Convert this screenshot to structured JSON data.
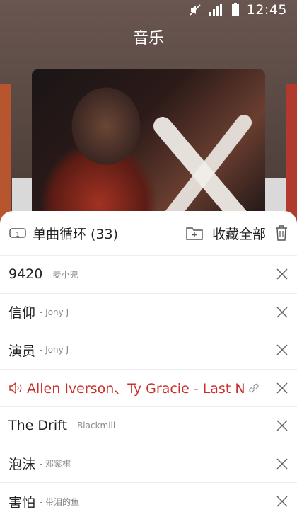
{
  "status_bar": {
    "time": "12:45"
  },
  "header": {
    "title": "音乐"
  },
  "playlist": {
    "mode_label": "单曲循环 (33)",
    "collect_label": "收藏全部",
    "tracks": [
      {
        "title": "9420",
        "artist": "- 麦小兜"
      },
      {
        "title": "信仰",
        "artist": "- Jony J"
      },
      {
        "title": "演员",
        "artist": "- Jony J"
      },
      {
        "title": "Allen Iverson、Ty Gracie - Last Ni···",
        "artist": "",
        "playing": true
      },
      {
        "title": "The Drift",
        "artist": "- Blackmill"
      },
      {
        "title": "泡沫",
        "artist": "- 邓紫棋"
      },
      {
        "title": "害怕",
        "artist": "- 带泪的鱼"
      }
    ]
  },
  "colors": {
    "accent": "#c8302b",
    "sheet_bg": "#ffffff",
    "header_bg": "#5a4843"
  }
}
